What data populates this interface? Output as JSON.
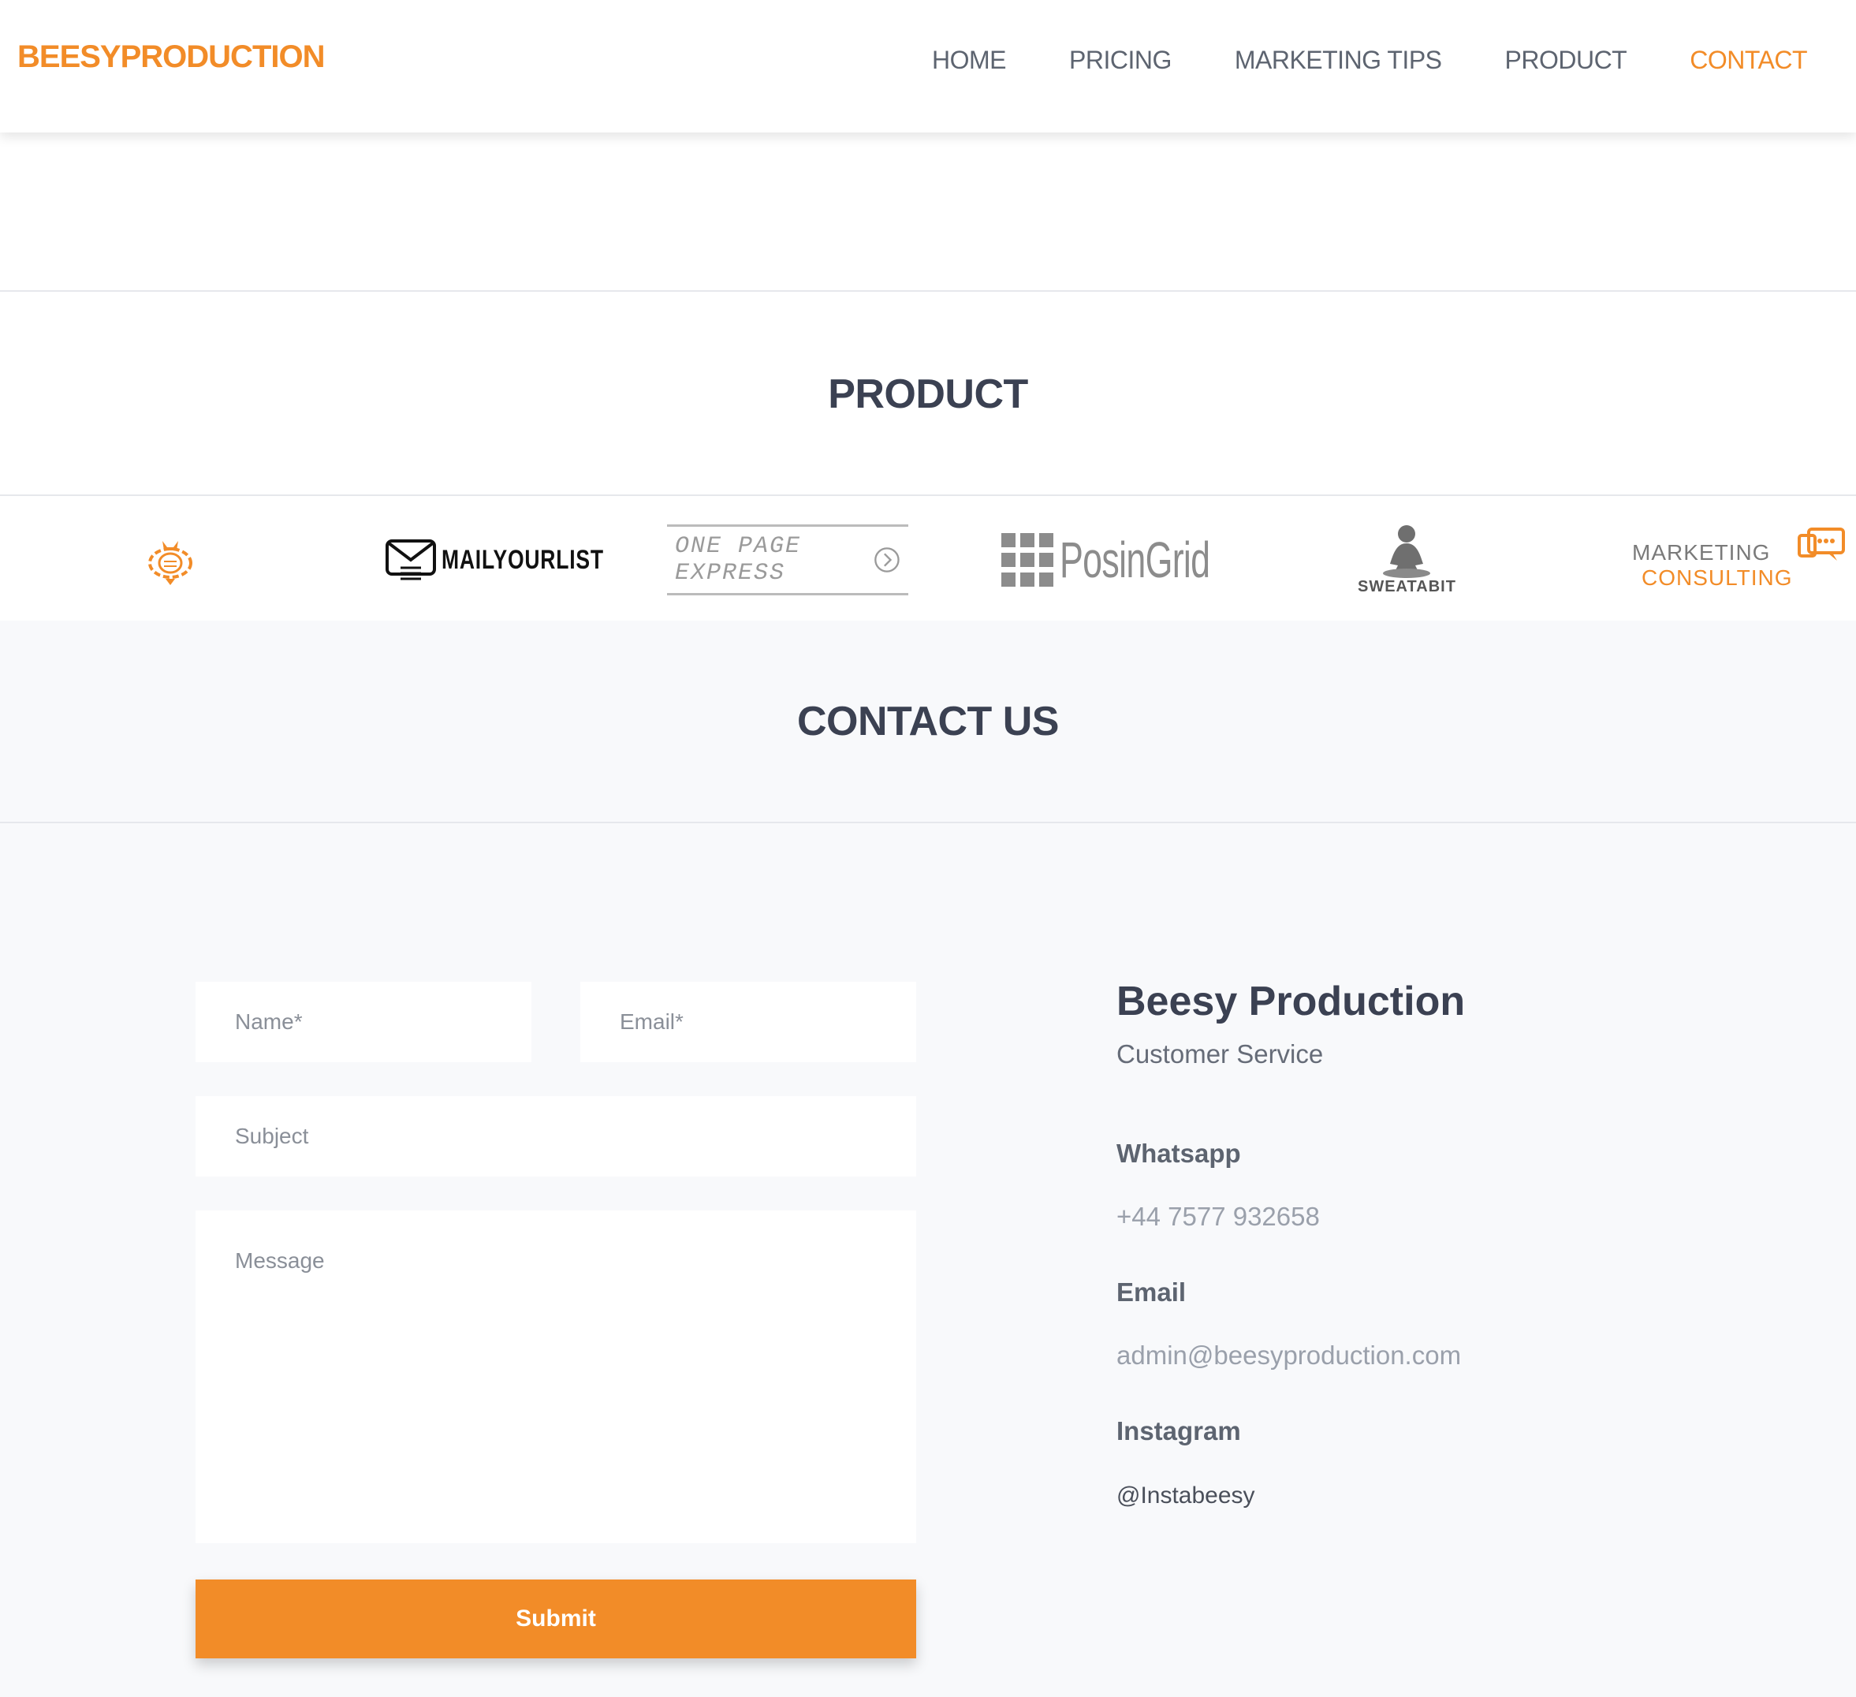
{
  "header": {
    "brand": "BEESYPRODUCTION",
    "nav": [
      {
        "label": "HOME",
        "active": false
      },
      {
        "label": "PRICING",
        "active": false
      },
      {
        "label": "MARKETING TIPS",
        "active": false
      },
      {
        "label": "PRODUCT",
        "active": false
      },
      {
        "label": "CONTACT",
        "active": true
      }
    ]
  },
  "product_section": {
    "title": "PRODUCT",
    "logos": [
      {
        "name": "bee-logo",
        "text": ""
      },
      {
        "name": "mailyourlist-logo",
        "text": "MAILYOURLIST"
      },
      {
        "name": "one-page-express-logo",
        "text": "ONE PAGE EXPRESS"
      },
      {
        "name": "posingrid-logo",
        "text": "PosinGrid"
      },
      {
        "name": "sweatabit-logo",
        "text": "SWEATABIT"
      },
      {
        "name": "marketing-consulting-logo",
        "text_top": "MARKETING",
        "text_bottom": "CONSULTING"
      }
    ]
  },
  "contact_section": {
    "title": "CONTACT US",
    "form": {
      "name_placeholder": "Name*",
      "email_placeholder": "Email*",
      "subject_placeholder": "Subject",
      "message_placeholder": "Message",
      "submit_label": "Submit"
    },
    "info": {
      "company": "Beesy Production",
      "department": "Customer Service",
      "whatsapp_label": "Whatsapp",
      "whatsapp_value": "+44 7577 932658",
      "email_label": "Email",
      "email_value": "admin@beesyproduction.com",
      "instagram_label": "Instagram",
      "instagram_value": "@Instabeesy"
    }
  },
  "colors": {
    "accent": "#f28c28",
    "heading": "#3b4152",
    "nav_text": "#5d6470",
    "contact_bg": "#f8f9fb"
  }
}
